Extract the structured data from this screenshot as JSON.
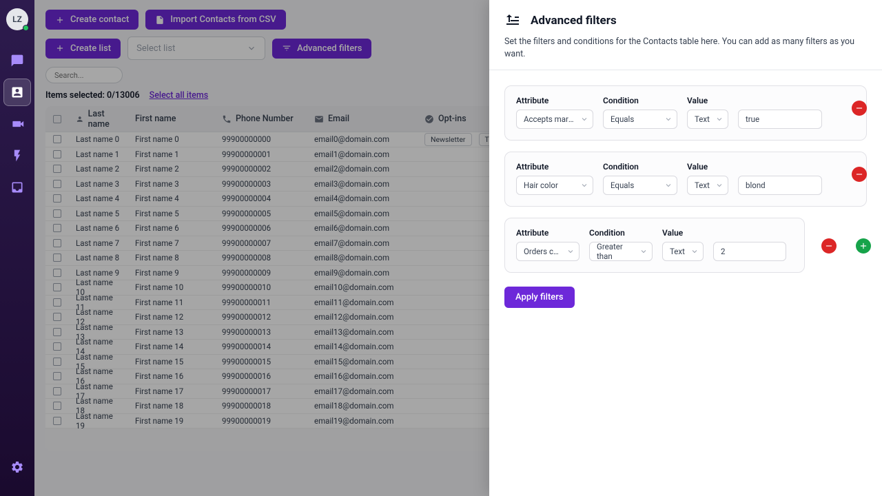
{
  "sidebar": {
    "avatar_initials": "LZ"
  },
  "toolbar": {
    "create_contact": "Create contact",
    "import_csv": "Import Contacts from CSV",
    "create_list": "Create list",
    "select_list_placeholder": "Select list",
    "advanced_filters": "Advanced filters",
    "search_placeholder": "Search..."
  },
  "selected": {
    "label": "Items selected: 0/13006",
    "select_all": "Select all items"
  },
  "table": {
    "headers": {
      "last_name": "Last name",
      "first_name": "First name",
      "phone": "Phone Number",
      "email": "Email",
      "optins": "Opt-ins"
    },
    "tags": [
      "Newsletter",
      "Tracki"
    ],
    "rows": [
      {
        "last": "Last name 0",
        "first": "First name 0",
        "phone": "99900000000",
        "email": "email0@domain.com",
        "optin": true
      },
      {
        "last": "Last name 1",
        "first": "First name 1",
        "phone": "99900000001",
        "email": "email1@domain.com"
      },
      {
        "last": "Last name 2",
        "first": "First name 2",
        "phone": "99900000002",
        "email": "email2@domain.com"
      },
      {
        "last": "Last name 3",
        "first": "First name 3",
        "phone": "99900000003",
        "email": "email3@domain.com"
      },
      {
        "last": "Last name 4",
        "first": "First name 4",
        "phone": "99900000004",
        "email": "email4@domain.com"
      },
      {
        "last": "Last name 5",
        "first": "First name 5",
        "phone": "99900000005",
        "email": "email5@domain.com"
      },
      {
        "last": "Last name 6",
        "first": "First name 6",
        "phone": "99900000006",
        "email": "email6@domain.com"
      },
      {
        "last": "Last name 7",
        "first": "First name 7",
        "phone": "99900000007",
        "email": "email7@domain.com"
      },
      {
        "last": "Last name 8",
        "first": "First name 8",
        "phone": "99900000008",
        "email": "email8@domain.com"
      },
      {
        "last": "Last name 9",
        "first": "First name 9",
        "phone": "99900000009",
        "email": "email9@domain.com"
      },
      {
        "last": "Last name 10",
        "first": "First name 10",
        "phone": "99900000010",
        "email": "email10@domain.com"
      },
      {
        "last": "Last name 11",
        "first": "First name 11",
        "phone": "99900000011",
        "email": "email11@domain.com"
      },
      {
        "last": "Last name 12",
        "first": "First name 12",
        "phone": "99900000012",
        "email": "email12@domain.com"
      },
      {
        "last": "Last name 13",
        "first": "First name 13",
        "phone": "99900000013",
        "email": "email13@domain.com"
      },
      {
        "last": "Last name 14",
        "first": "First name 14",
        "phone": "99900000014",
        "email": "email14@domain.com"
      },
      {
        "last": "Last name 15",
        "first": "First name 15",
        "phone": "99900000015",
        "email": "email15@domain.com"
      },
      {
        "last": "Last name 16",
        "first": "First name 16",
        "phone": "99900000016",
        "email": "email16@domain.com"
      },
      {
        "last": "Last name 17",
        "first": "First name 17",
        "phone": "99900000017",
        "email": "email17@domain.com"
      },
      {
        "last": "Last name 18",
        "first": "First name 18",
        "phone": "99900000018",
        "email": "email18@domain.com"
      },
      {
        "last": "Last name 19",
        "first": "First name 19",
        "phone": "99900000019",
        "email": "email19@domain.com"
      }
    ]
  },
  "drawer": {
    "title": "Advanced filters",
    "description": "Set the filters and conditions for the Contacts table here. You can add as many filters as you want.",
    "labels": {
      "attribute": "Attribute",
      "condition": "Condition",
      "value": "Value"
    },
    "type_text": "Text",
    "filters": [
      {
        "attribute": "Accepts marketi...",
        "condition": "Equals",
        "value": "true"
      },
      {
        "attribute": "Hair color",
        "condition": "Equals",
        "value": "blond"
      },
      {
        "attribute": "Orders count",
        "condition": "Greater than",
        "value": "2"
      }
    ],
    "apply": "Apply filters"
  }
}
